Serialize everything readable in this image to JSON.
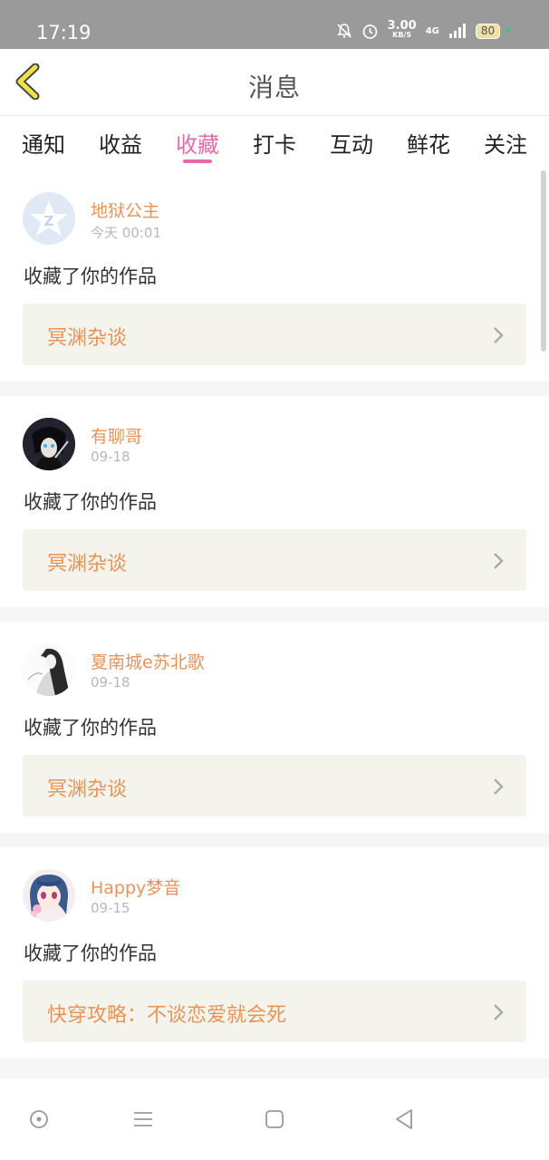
{
  "status": {
    "time": "17:19",
    "speed_value": "3.00",
    "speed_unit": "KB/S",
    "network": "4G",
    "battery": "80"
  },
  "header": {
    "title": "消息"
  },
  "tabs": [
    {
      "label": "通知",
      "active": false
    },
    {
      "label": "收益",
      "active": false
    },
    {
      "label": "收藏",
      "active": true
    },
    {
      "label": "打卡",
      "active": false
    },
    {
      "label": "互动",
      "active": false
    },
    {
      "label": "鲜花",
      "active": false
    },
    {
      "label": "关注",
      "active": false
    }
  ],
  "messages": [
    {
      "user": "地狱公主",
      "time": "今天 00:01",
      "action": "收藏了你的作品",
      "work": "冥渊杂谈",
      "avatar": "qzone-star-icon"
    },
    {
      "user": "有聊哥",
      "time": "09-18",
      "action": "收藏了你的作品",
      "work": "冥渊杂谈",
      "avatar": "anime-character-dark"
    },
    {
      "user": "夏南城e苏北歌",
      "time": "09-18",
      "action": "收藏了你的作品",
      "work": "冥渊杂谈",
      "avatar": "sketch-girl"
    },
    {
      "user": "Happy梦音",
      "time": "09-15",
      "action": "收藏了你的作品",
      "work": "快穿攻略：不谈恋爱就会死",
      "avatar": "anime-girl-blue-hair"
    }
  ],
  "colors": {
    "accent": "#e36aa6",
    "username": "#e8935a",
    "statusbar": "#9a9a9a"
  }
}
